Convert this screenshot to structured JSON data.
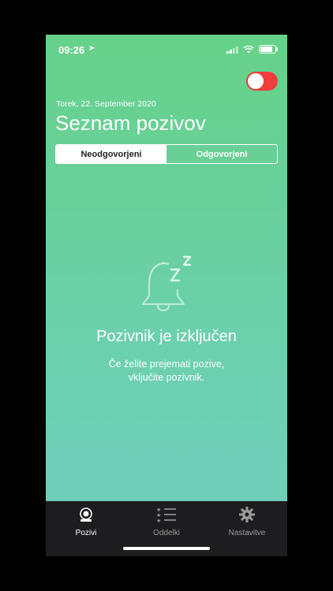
{
  "status": {
    "time": "09:26",
    "location_icon": "location-arrow-icon"
  },
  "header": {
    "date": "Torek, 22. September 2020",
    "title": "Seznam pozivov"
  },
  "segments": [
    {
      "label": "Neodgovorjeni",
      "active": true
    },
    {
      "label": "Odgovorjeni",
      "active": false
    }
  ],
  "empty_state": {
    "icon": "bell-sleep-icon",
    "title": "Pozivnik je izključen",
    "description": "Če želite prejemati pozive, vključite pozivnik."
  },
  "tabs": [
    {
      "label": "Pozivi",
      "icon": "alarm-bell-icon",
      "active": true
    },
    {
      "label": "Oddelki",
      "icon": "star-list-icon",
      "active": false
    },
    {
      "label": "Nastavitve",
      "icon": "gear-icon",
      "active": false
    }
  ],
  "colors": {
    "accent_green": "#66d189",
    "toggle_off": "#f13c3c",
    "tabbar": "#1d1d1f"
  }
}
